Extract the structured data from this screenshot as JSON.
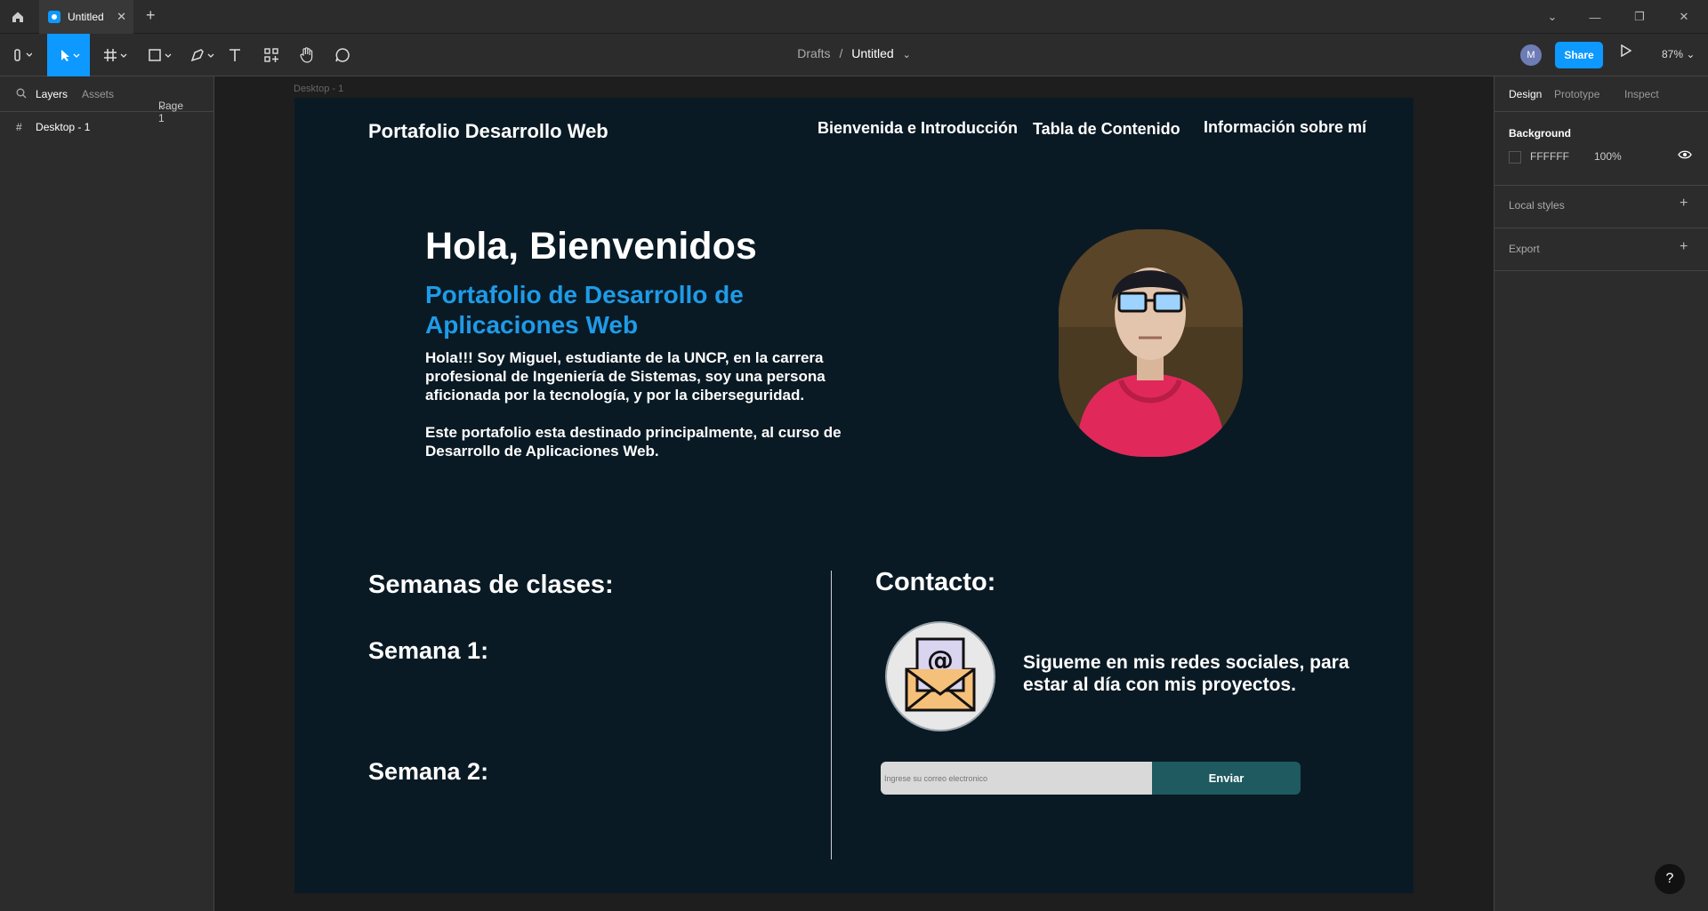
{
  "tabbar": {
    "tab_title": "Untitled"
  },
  "toolbar": {
    "breadcrumb_parent": "Drafts",
    "breadcrumb_sep": "/",
    "breadcrumb_file": "Untitled",
    "avatar_initial": "M",
    "share_label": "Share",
    "zoom": "87%"
  },
  "left_panel": {
    "tabs": [
      "Layers",
      "Assets"
    ],
    "page": "Page 1",
    "layers": [
      {
        "label": "Desktop - 1"
      }
    ]
  },
  "right_panel": {
    "tabs": [
      "Design",
      "Prototype",
      "Inspect"
    ],
    "background_label": "Background",
    "bg_hex": "FFFFFF",
    "bg_opacity": "100%",
    "local_styles": "Local styles",
    "export": "Export"
  },
  "canvas": {
    "frame_label": "Desktop - 1",
    "site_title": "Portafolio Desarrollo Web",
    "nav": [
      "Bienvenida e Introducción",
      "Tabla de Contenido",
      "Información sobre mí"
    ],
    "hero_title": "Hola, Bienvenidos",
    "hero_subtitle": "Portafolio de Desarrollo de Aplicaciones Web",
    "intro_1": "Hola!!! Soy Miguel, estudiante de la UNCP, en la carrera profesional de Ingeniería de Sistemas, soy una persona aficionada por la tecnología, y por la ciberseguridad.",
    "intro_2": "Este portafolio esta destinado principalmente, al curso de Desarrollo de Aplicaciones Web.",
    "weeks_title": "Semanas de clases:",
    "week_1": "Semana 1:",
    "week_2": "Semana 2:",
    "contact_title": "Contacto:",
    "social_text": "Sigueme en mis redes sociales, para estar al día con mis proyectos.",
    "email_placeholder": "Ingrese su correo electronico",
    "send_label": "Enviar"
  },
  "colors": {
    "frame_bg": "#0a1a24",
    "accent": "#1e9be8",
    "button": "#1f5a60",
    "figma_blue": "#0d99ff"
  }
}
